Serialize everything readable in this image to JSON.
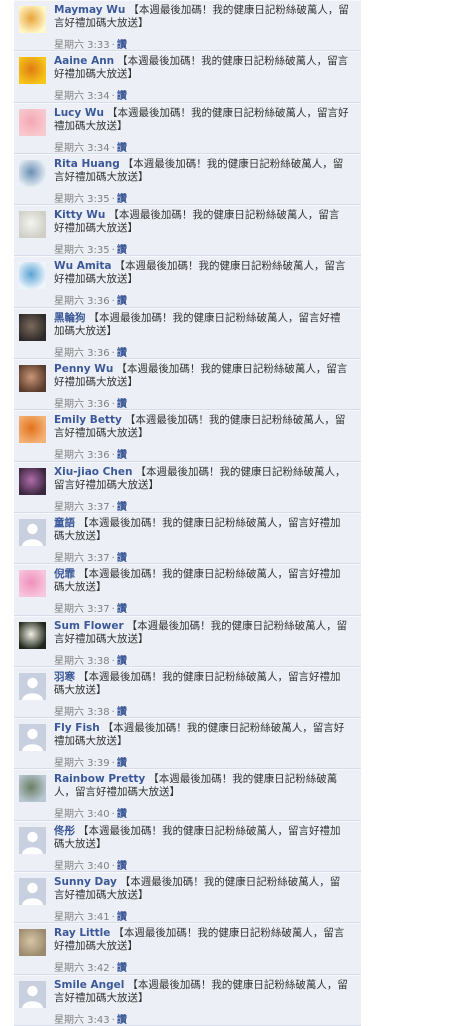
{
  "comments": [
    {
      "name": "Maymay Wu",
      "text": "【本週最後加碼！我的健康日記粉絲破萬人，留言好禮加碼大放送】",
      "time": "星期六 3:33",
      "like": "讚",
      "avatar": "avatar-yellow-girl",
      "colors": [
        "#fff8c9",
        "#e8a43a"
      ]
    },
    {
      "name": "Aaine Ann",
      "text": "【本週最後加碼！我的健康日記粉絲破萬人，留言好禮加碼大放送】",
      "time": "星期六 3:34",
      "like": "讚",
      "avatar": "avatar-smiley",
      "colors": [
        "#f6c619",
        "#e07b12"
      ]
    },
    {
      "name": "Lucy Wu",
      "text": "【本週最後加碼！我的健康日記粉絲破萬人，留言好禮加碼大放送】",
      "time": "星期六 3:34",
      "like": "讚",
      "avatar": "avatar-pink",
      "colors": [
        "#f8c9cf",
        "#f4a8b3"
      ]
    },
    {
      "name": "Rita Huang",
      "text": "【本週最後加碼！我的健康日記粉絲破萬人，留言好禮加碼大放送】",
      "time": "星期六 3:35",
      "like": "讚",
      "avatar": "avatar-cartoon",
      "colors": [
        "#e9f0f6",
        "#6b8fb5"
      ]
    },
    {
      "name": "Kitty Wu",
      "text": "【本週最後加碼！我的健康日記粉絲破萬人，留言好禮加碼大放送】",
      "time": "星期六 3:35",
      "like": "讚",
      "avatar": "avatar-dandelion",
      "colors": [
        "#cfcfc7",
        "#f4f4f0"
      ]
    },
    {
      "name": "Wu Amita",
      "text": "【本週最後加碼！我的健康日記粉絲破萬人，留言好禮加碼大放送】",
      "time": "星期六 3:36",
      "like": "讚",
      "avatar": "avatar-blue-drawing",
      "colors": [
        "#eef6fb",
        "#5aa3d6"
      ]
    },
    {
      "name": "黑輪狗",
      "text": "【本週最後加碼！我的健康日記粉絲破萬人，留言好禮加碼大放送】",
      "time": "星期六 3:36",
      "like": "讚",
      "avatar": "avatar-dark-photo",
      "colors": [
        "#2e2a2a",
        "#7c6a5c"
      ]
    },
    {
      "name": "Penny Wu",
      "text": "【本週最後加碼！我的健康日記粉絲破萬人，留言好禮加碼大放送】",
      "time": "星期六 3:36",
      "like": "讚",
      "avatar": "avatar-portrait",
      "colors": [
        "#5a3b2c",
        "#c99677"
      ]
    },
    {
      "name": "Emily Betty",
      "text": "【本週最後加碼！我的健康日記粉絲破萬人，留言好禮加碼大放送】",
      "time": "星期六 3:36",
      "like": "讚",
      "avatar": "avatar-butterfly",
      "colors": [
        "#f3b277",
        "#e4721b"
      ]
    },
    {
      "name": "Xiu-jiao Chen",
      "text": "【本週最後加碼！我的健康日記粉絲破萬人，留言好禮加碼大放送】",
      "time": "星期六 3:37",
      "like": "讚",
      "avatar": "avatar-flower-purple",
      "colors": [
        "#3a2740",
        "#b06ba8"
      ]
    },
    {
      "name": "童語",
      "text": "【本週最後加碼！我的健康日記粉絲破萬人，留言好禮加碼大放送】",
      "time": "星期六 3:37",
      "like": "讚",
      "avatar": "avatar-default",
      "colors": [
        "#c8cfdf",
        "#ffffff"
      ]
    },
    {
      "name": "倪霏",
      "text": "【本週最後加碼！我的健康日記粉絲破萬人，留言好禮加碼大放送】",
      "time": "星期六 3:37",
      "like": "讚",
      "avatar": "avatar-pink-flower",
      "colors": [
        "#f7c6dc",
        "#ef8fbd"
      ]
    },
    {
      "name": "Sum Flower",
      "text": "【本週最後加碼！我的健康日記粉絲破萬人，留言好禮加碼大放送】",
      "time": "星期六 3:38",
      "like": "讚",
      "avatar": "avatar-white-flower",
      "colors": [
        "#20261b",
        "#f2efe3"
      ]
    },
    {
      "name": "羽寒",
      "text": "【本週最後加碼！我的健康日記粉絲破萬人，留言好禮加碼大放送】",
      "time": "星期六 3:38",
      "like": "讚",
      "avatar": "avatar-default",
      "colors": [
        "#c8cfdf",
        "#ffffff"
      ]
    },
    {
      "name": "Fly Fish",
      "text": "【本週最後加碼！我的健康日記粉絲破萬人，留言好禮加碼大放送】",
      "time": "星期六 3:39",
      "like": "讚",
      "avatar": "avatar-default",
      "colors": [
        "#c8cfdf",
        "#ffffff"
      ]
    },
    {
      "name": "Rainbow Pretty",
      "text": "【本週最後加碼！我的健康日記粉絲破萬人，留言好禮加碼大放送】",
      "time": "星期六 3:40",
      "like": "讚",
      "avatar": "avatar-landscape",
      "colors": [
        "#b9c7d2",
        "#6b7f63"
      ]
    },
    {
      "name": "佟彤",
      "text": "【本週最後加碼！我的健康日記粉絲破萬人，留言好禮加碼大放送】",
      "time": "星期六 3:40",
      "like": "讚",
      "avatar": "avatar-default",
      "colors": [
        "#c8cfdf",
        "#ffffff"
      ]
    },
    {
      "name": "Sunny Day",
      "text": "【本週最後加碼！我的健康日記粉絲破萬人，留言好禮加碼大放送】",
      "time": "星期六 3:41",
      "like": "讚",
      "avatar": "avatar-default",
      "colors": [
        "#c8cfdf",
        "#ffffff"
      ]
    },
    {
      "name": "Ray Little",
      "text": "【本週最後加碼！我的健康日記粉絲破萬人，留言好禮加碼大放送】",
      "time": "星期六 3:42",
      "like": "讚",
      "avatar": "avatar-cat",
      "colors": [
        "#9b8a6e",
        "#d6c6a4"
      ]
    },
    {
      "name": "Smile Angel",
      "text": "【本週最後加碼！我的健康日記粉絲破萬人，留言好禮加碼大放送】",
      "time": "星期六 3:43",
      "like": "讚",
      "avatar": "avatar-default",
      "colors": [
        "#c8cfdf",
        "#ffffff"
      ]
    }
  ]
}
